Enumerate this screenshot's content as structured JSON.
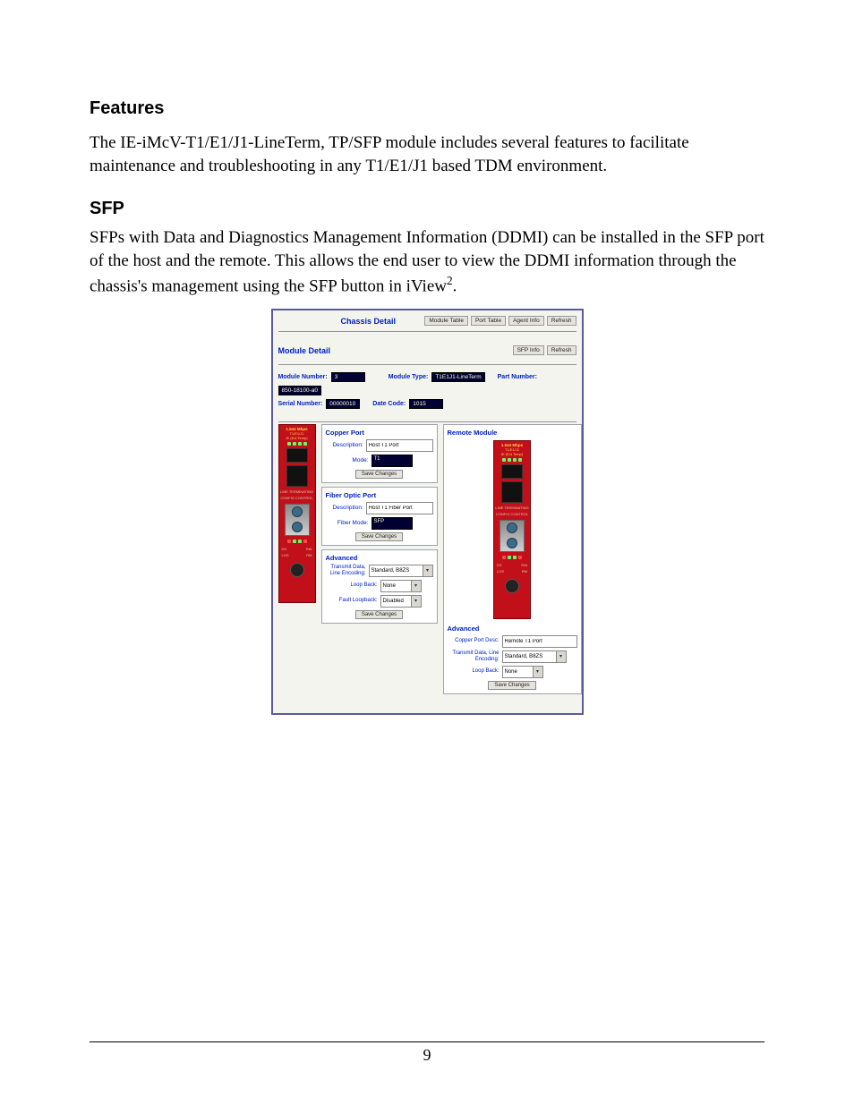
{
  "headings": {
    "features": "Features",
    "sfp": "SFP"
  },
  "paragraphs": {
    "features": "The IE-iMcV-T1/E1/J1-LineTerm, TP/SFP module includes several features to facilitate maintenance and troubleshooting in any T1/E1/J1 based TDM environment.",
    "sfp_1": "SFPs with Data and Diagnostics Management Information (DDMI) can be installed in the SFP port of the host and the remote.  This allows the end user to view the DDMI information through the chassis's management using the SFP button in iView",
    "sfp_sup": "2",
    "sfp_end": "."
  },
  "screenshot": {
    "chassis_title": "Chassis Detail",
    "top_buttons": {
      "module_table": "Module Table",
      "port_table": "Port Table",
      "agent_info": "Agent Info",
      "refresh": "Refresh"
    },
    "mod_detail_title": "Module Detail",
    "mod_buttons": {
      "sfp_info": "SFP Info",
      "refresh": "Refresh"
    },
    "info": {
      "module_number_label": "Module Number:",
      "module_number": "3",
      "module_type_label": "Module Type:",
      "module_type": "T1E1J1-LineTerm",
      "part_number_label": "Part Number:",
      "part_number": "850-18100-a0",
      "serial_number_label": "Serial Number:",
      "serial_number": "00000010",
      "date_code_label": "Date Code:",
      "date_code": "1015"
    },
    "device": {
      "rate": "1.544 Mbps",
      "model": "T1/E1/J1",
      "temp": "IE (Ext Temp)",
      "line_term": "LINE TERMINATING",
      "config": "CONFIG CONTROL",
      "sfp": "SFP",
      "bottom1": "DS",
      "bottom2": "RAI",
      "bottom3": "LOS",
      "bottom4": "RM"
    },
    "copper": {
      "title": "Copper Port",
      "desc_label": "Description:",
      "desc_value": "Host T1 Port",
      "mode_label": "Mode:",
      "mode_value": "T1",
      "save": "Save Changes"
    },
    "fiber": {
      "title": "Fiber Optic Port",
      "desc_label": "Description:",
      "desc_value": "Host T1 Fiber Port",
      "mode_label": "Fiber Mode:",
      "mode_value": "SFP",
      "save": "Save Changes"
    },
    "advanced": {
      "title": "Advanced",
      "encoding_label": "Transmit Data, Line Encoding:",
      "encoding_value": "Standard, B8ZS",
      "loopback_label": "Loop Back:",
      "loopback_value": "None",
      "fault_label": "Fault Loopback:",
      "fault_value": "Disabled",
      "save": "Save Changes"
    },
    "remote": {
      "title": "Remote Module",
      "adv_title": "Advanced",
      "portdesc_label": "Copper Port Desc:",
      "portdesc_value": "Remote T1 Port",
      "encoding_label": "Transmit Data, Line Encoding:",
      "encoding_value": "Standard, B8ZS",
      "loopback_label": "Loop Back:",
      "loopback_value": "None",
      "save": "Save Changes"
    }
  },
  "page_number": "9"
}
